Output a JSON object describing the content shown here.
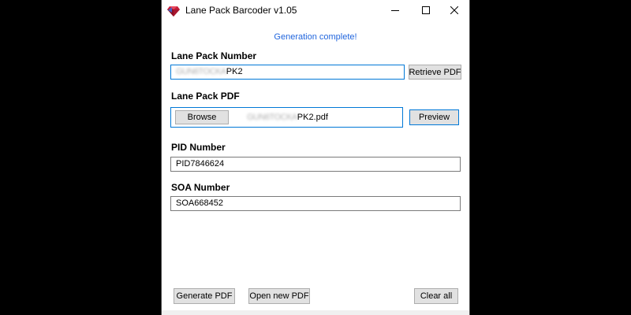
{
  "window": {
    "title": "Lane Pack Barcoder v1.05",
    "app_icon": "ruby-gem-icon",
    "controls": {
      "minimize": "minimize-icon",
      "maximize": "maximize-icon",
      "close": "close-icon"
    }
  },
  "status_message": "Generation complete!",
  "colors": {
    "status": "#2266dd",
    "focus_border": "#0078d7",
    "button_bg": "#e1e1e1"
  },
  "lane_pack_number": {
    "label": "Lane Pack Number",
    "value_obscured": "GUN6TOCKA",
    "value_suffix": "PK2",
    "retrieve_button": "Retrieve PDF"
  },
  "lane_pack_pdf": {
    "label": "Lane Pack PDF",
    "browse_button": "Browse",
    "file_obscured": "GUN6TOCKA",
    "file_suffix": "PK2.pdf",
    "preview_button": "Preview"
  },
  "pid_number": {
    "label": "PID Number",
    "value": "PID7846624"
  },
  "soa_number": {
    "label": "SOA Number",
    "value": "SOA668452"
  },
  "actions": {
    "generate": "Generate PDF",
    "open_new": "Open new PDF",
    "clear_all": "Clear all"
  }
}
